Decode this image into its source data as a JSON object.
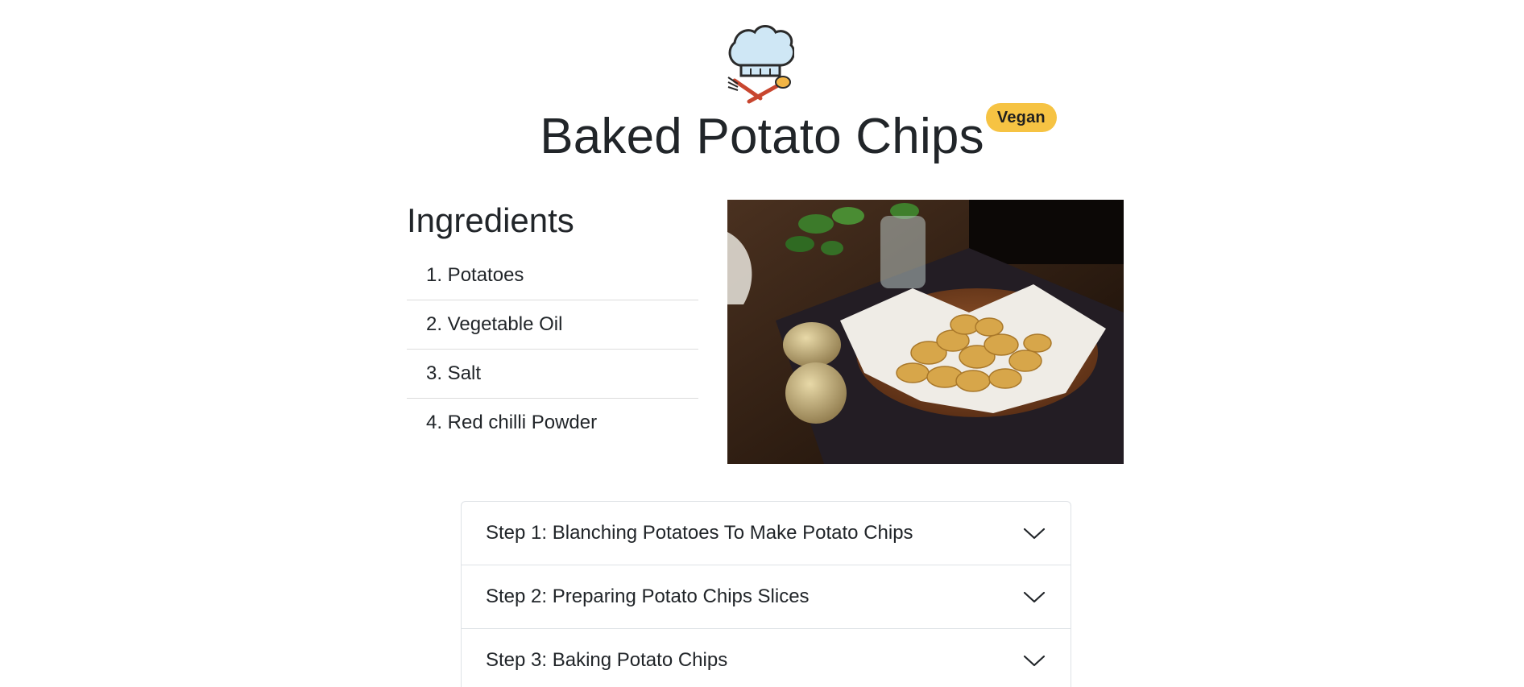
{
  "recipe": {
    "title": "Baked Potato Chips",
    "badge": "Vegan"
  },
  "ingredients": {
    "heading": "Ingredients",
    "items": [
      "1. Potatoes",
      "2. Vegetable Oil",
      "3. Salt",
      "4. Red chilli Powder"
    ]
  },
  "steps": [
    "Step 1: Blanching Potatoes To Make Potato Chips",
    "Step 2: Preparing Potato Chips Slices",
    "Step 3: Baking Potato Chips"
  ],
  "colors": {
    "badge": "#f6c343",
    "text": "#212529"
  },
  "icons": {
    "logo": "chef-hat-utensils-icon",
    "chevron": "chevron-down-icon"
  }
}
